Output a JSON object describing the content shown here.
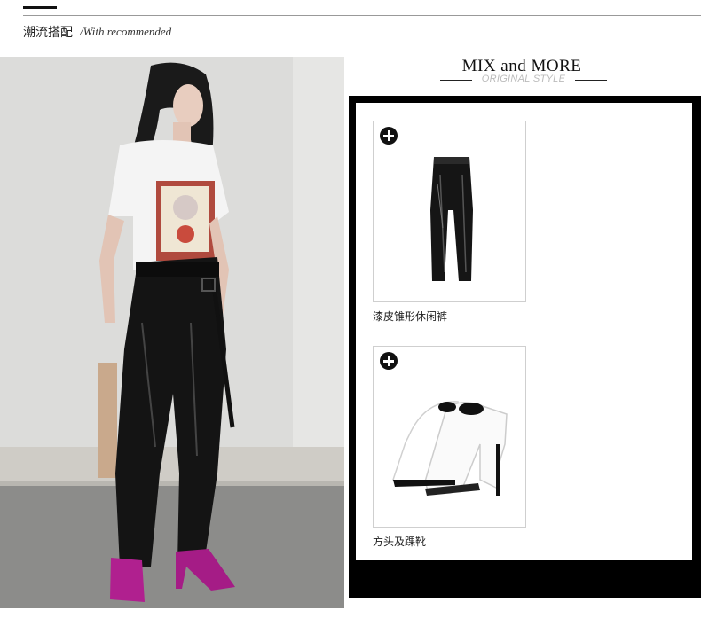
{
  "header": {
    "title": "潮流搭配",
    "subtitle": "/With recommended"
  },
  "mix": {
    "title": "MIX and MORE",
    "subtitle": "ORIGINAL STYLE"
  },
  "products": [
    {
      "name": "漆皮锥形休闲裤",
      "icon": "plus-circle-icon"
    },
    {
      "name": "方头及踝靴",
      "icon": "plus-circle-icon"
    }
  ],
  "colors": {
    "frame": "#000000",
    "accent": "#111111",
    "subtitle_gray": "#bbbbbb",
    "shoe_magenta": "#b0208f"
  }
}
